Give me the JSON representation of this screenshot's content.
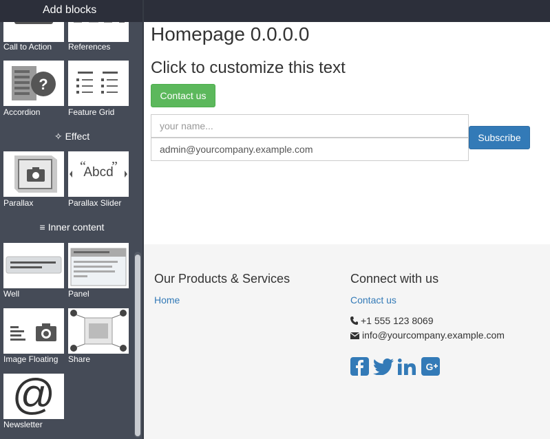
{
  "sidebar": {
    "header_title": "Add blocks",
    "tiles": {
      "call_to_action": "Call to Action",
      "references": "References",
      "accordion": "Accordion",
      "feature_grid": "Feature Grid",
      "parallax": "Parallax",
      "parallax_slider": "Parallax Slider",
      "well": "Well",
      "panel": "Panel",
      "image_floating": "Image Floating",
      "share": "Share",
      "newsletter": "Newsletter"
    },
    "sections": {
      "effect": "Effect",
      "inner_content": "Inner content"
    },
    "parallax_slider_text": "Abcd"
  },
  "page": {
    "title": "Homepage 0.0.0.0",
    "subtitle": "Click to customize this text",
    "contact_button": "Contact us",
    "name_placeholder": "your name...",
    "email_value": "admin@yourcompany.example.com",
    "subscribe_button": "Subscribe"
  },
  "footer": {
    "products_heading": "Our Products & Services",
    "home_link": "Home",
    "connect_heading": "Connect with us",
    "contact_link": "Contact us",
    "phone": "+1 555 123 8069",
    "email": "info@yourcompany.example.com",
    "social_icons": [
      "facebook-icon",
      "twitter-icon",
      "linkedin-icon",
      "google-plus-icon"
    ]
  },
  "colors": {
    "sidebar_bg": "#454b57",
    "topbar_bg": "#2c2f3a",
    "success": "#5cb85c",
    "primary": "#337ab7"
  }
}
